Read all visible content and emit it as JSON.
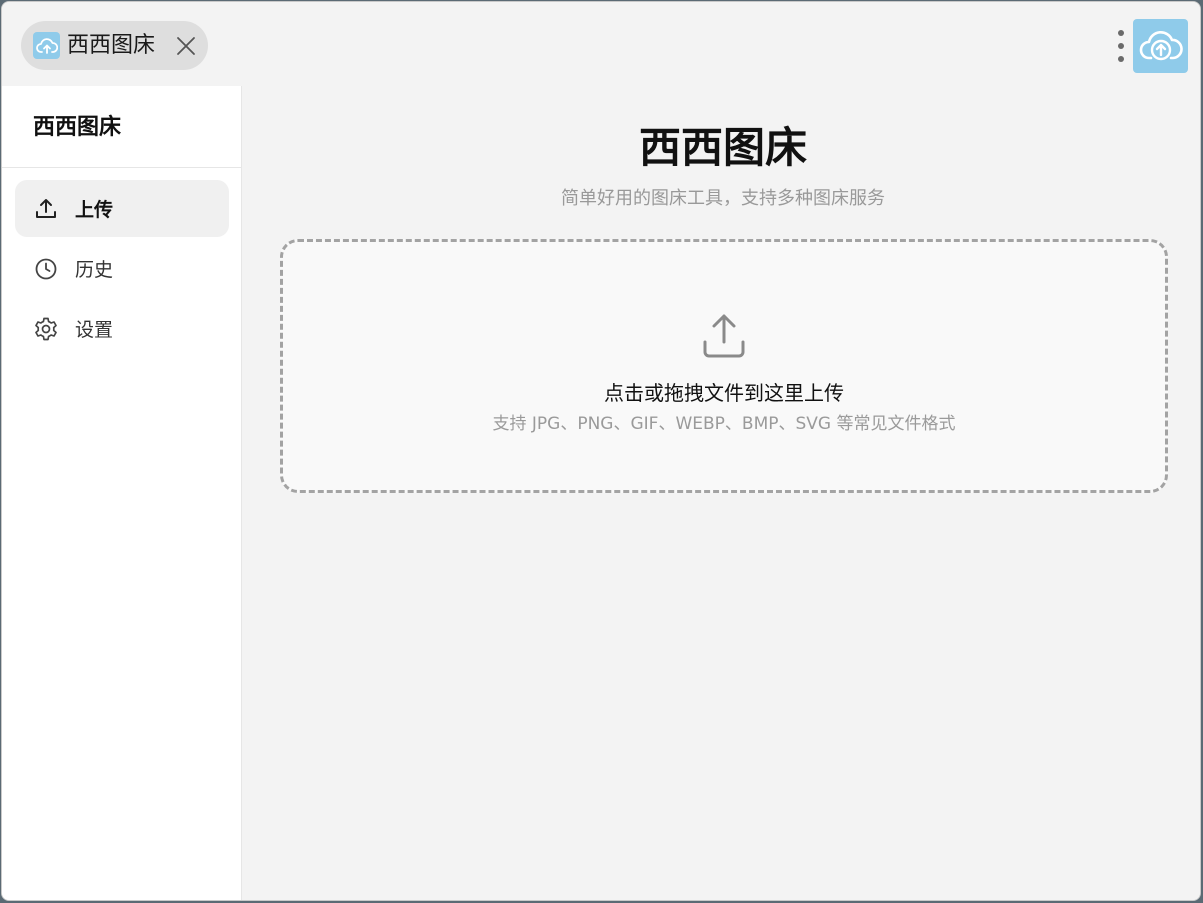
{
  "window": {
    "tab": {
      "label": "西西图床",
      "icon": "cloud-upload-icon"
    },
    "menu_icon": "more-vertical-icon",
    "app_icon": "cloud-upload-icon",
    "accent_color": "#8fcbea"
  },
  "sidebar": {
    "title": "西西图床",
    "items": [
      {
        "label": "上传",
        "icon": "upload-icon",
        "active": true
      },
      {
        "label": "历史",
        "icon": "clock-icon",
        "active": false
      },
      {
        "label": "设置",
        "icon": "gear-icon",
        "active": false
      }
    ]
  },
  "main": {
    "title": "西西图床",
    "subtitle": "简单好用的图床工具，支持多种图床服务",
    "dropzone": {
      "icon": "upload-icon",
      "text": "点击或拖拽文件到这里上传",
      "hint": "支持 JPG、PNG、GIF、WEBP、BMP、SVG 等常见文件格式"
    }
  }
}
